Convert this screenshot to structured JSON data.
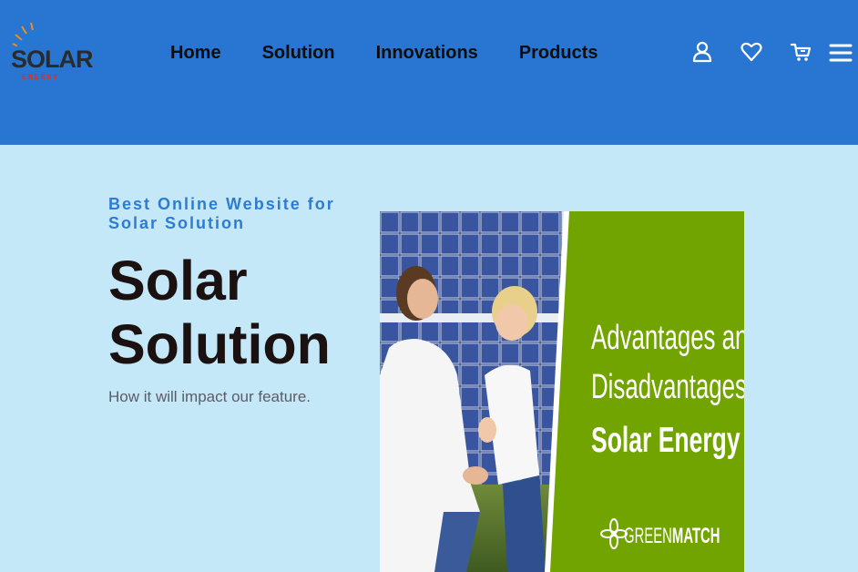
{
  "logo": {
    "text": "SOLAR",
    "sub": "ENERGY"
  },
  "nav": {
    "items": [
      "Home",
      "Solution",
      "Innovations",
      "Products"
    ]
  },
  "header_icons": [
    "user-icon",
    "heart-icon",
    "cart-icon",
    "menu-icon"
  ],
  "hero": {
    "eyebrow": "Best Online Website for Solar Solution",
    "title": "Solar Solution",
    "subtitle": "How it will impact our feature."
  },
  "banner": {
    "line1": "Advantages and",
    "line2": "Disadvantages of",
    "line3": "Solar Energy",
    "brand_light": "GREEN",
    "brand_bold": "MATCH"
  },
  "colors": {
    "header": "#2876d2",
    "page_bg": "#c4e8f7",
    "accent": "#2e7bd4",
    "banner_green": "#72a400"
  }
}
